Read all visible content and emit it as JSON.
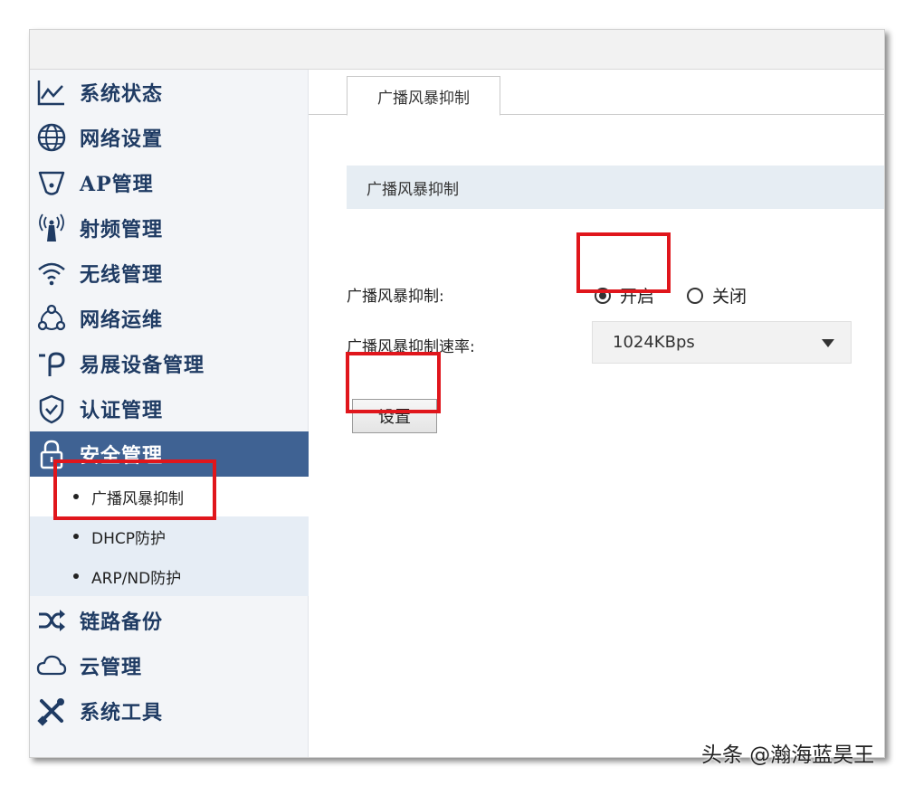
{
  "sidebar": {
    "items": [
      {
        "label": "系统状态",
        "icon": "line-chart-icon"
      },
      {
        "label": "网络设置",
        "icon": "globe-icon"
      },
      {
        "label": "AP管理",
        "icon": "access-point-icon"
      },
      {
        "label": "射频管理",
        "icon": "antenna-icon"
      },
      {
        "label": "无线管理",
        "icon": "wifi-icon"
      },
      {
        "label": "网络运维",
        "icon": "network-nodes-icon"
      },
      {
        "label": "易展设备管理",
        "icon": "yizhan-logo-icon"
      },
      {
        "label": "认证管理",
        "icon": "shield-check-icon"
      },
      {
        "label": "安全管理",
        "icon": "lock-icon"
      },
      {
        "label": "链路备份",
        "icon": "shuffle-icon"
      },
      {
        "label": "云管理",
        "icon": "cloud-icon"
      },
      {
        "label": "系统工具",
        "icon": "tools-icon"
      }
    ],
    "sub_items": [
      {
        "label": "广播风暴抑制"
      },
      {
        "label": "DHCP防护"
      },
      {
        "label": "ARP/ND防护"
      }
    ]
  },
  "main": {
    "tab_label": "广播风暴抑制",
    "section_title": "广播风暴抑制",
    "form": {
      "suppression_label": "广播风暴抑制:",
      "option_on": "开启",
      "option_off": "关闭",
      "selected_option": "开启",
      "rate_label": "广播风暴抑制速率:",
      "rate_value": "1024KBps"
    },
    "submit_label": "设置"
  },
  "watermark": "头条 @瀚海蓝昊王",
  "colors": {
    "nav_active_bg": "#3f6293",
    "nav_text": "#1f3b63",
    "highlight_box": "#e0161c",
    "submenu_bg": "#e6edf5",
    "section_header_bg": "#e6edf3"
  }
}
